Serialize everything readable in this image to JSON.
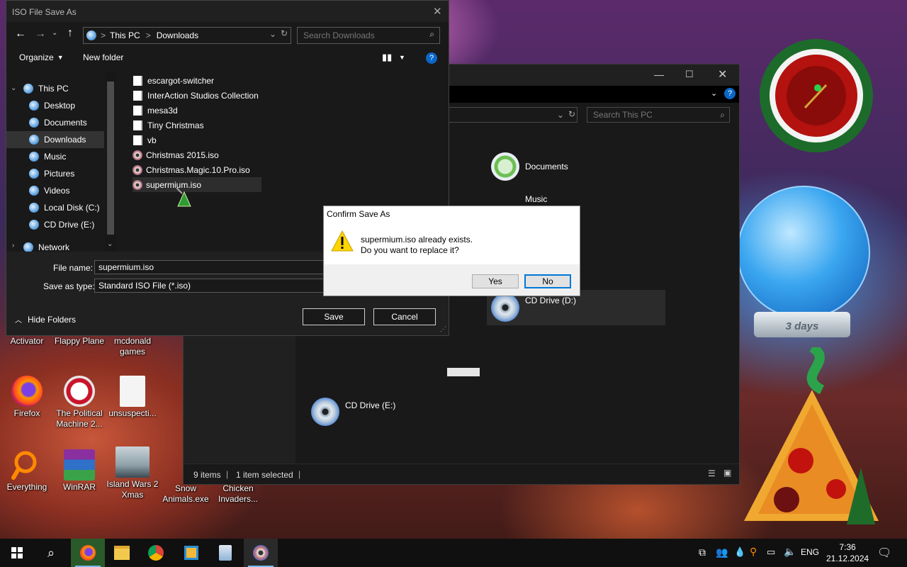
{
  "save_dialog": {
    "title": "ISO File Save As",
    "address": [
      "This PC",
      "Downloads"
    ],
    "address_sep": ">",
    "search_placeholder": "Search Downloads",
    "toolbar": {
      "organize": "Organize",
      "new_folder": "New folder"
    },
    "tree": [
      {
        "label": "This PC",
        "level": 0
      },
      {
        "label": "Desktop",
        "level": 1
      },
      {
        "label": "Documents",
        "level": 1
      },
      {
        "label": "Downloads",
        "level": 1,
        "selected": true
      },
      {
        "label": "Music",
        "level": 1
      },
      {
        "label": "Pictures",
        "level": 1
      },
      {
        "label": "Videos",
        "level": 1
      },
      {
        "label": "Local Disk (C:)",
        "level": 1
      },
      {
        "label": "CD Drive (E:)",
        "level": 1
      },
      {
        "label": "Network",
        "level": 0
      }
    ],
    "files": [
      {
        "name": "escargot-switcher",
        "type": "folder"
      },
      {
        "name": "InterAction Studios Collection",
        "type": "folder"
      },
      {
        "name": "mesa3d",
        "type": "folder"
      },
      {
        "name": "Tiny Christmas",
        "type": "folder"
      },
      {
        "name": "vb",
        "type": "folder"
      },
      {
        "name": "Christmas 2015.iso",
        "type": "iso"
      },
      {
        "name": "Christmas.Magic.10.Pro.iso",
        "type": "iso"
      },
      {
        "name": "supermium.iso",
        "type": "iso",
        "selected": true
      }
    ],
    "file_name_label": "File name:",
    "file_name_value": "supermium.iso",
    "save_type_label": "Save as type:",
    "save_type_value": "Standard ISO File (*.iso)",
    "hide_folders": "Hide Folders",
    "save_button": "Save",
    "cancel_button": "Cancel"
  },
  "confirm_dialog": {
    "title": "Confirm Save As",
    "line1": "supermium.iso already exists.",
    "line2": "Do you want to replace it?",
    "yes": "Yes",
    "no": "No"
  },
  "explorer": {
    "search_placeholder": "Search This PC",
    "drives": [
      {
        "label": "Documents"
      },
      {
        "label": "Music"
      },
      {
        "label": "CD Drive (D:)"
      },
      {
        "label": "CD Drive (E:)"
      }
    ],
    "status_items": "9 items",
    "status_selected": "1 item selected"
  },
  "desktop_icons": [
    {
      "label": "Activator"
    },
    {
      "label": "Flappy Plane"
    },
    {
      "label": "mcdonald games"
    },
    {
      "label": "Firefox"
    },
    {
      "label": "The Political Machine 2..."
    },
    {
      "label": "unsuspecti..."
    },
    {
      "label": "Everything"
    },
    {
      "label": "WinRAR"
    },
    {
      "label": "Island Wars 2 Xmas"
    },
    {
      "label": "Snow Animals.exe"
    },
    {
      "label": "Chicken Invaders..."
    }
  ],
  "widgets": {
    "snowglobe_text": "3 days"
  },
  "taskbar": {
    "language": "ENG",
    "time": "7:36",
    "date": "21.12.2024"
  },
  "colors": {
    "accent": "#0078d7",
    "dark_bg": "#191919",
    "dialog_bg": "#f0f0f0"
  }
}
